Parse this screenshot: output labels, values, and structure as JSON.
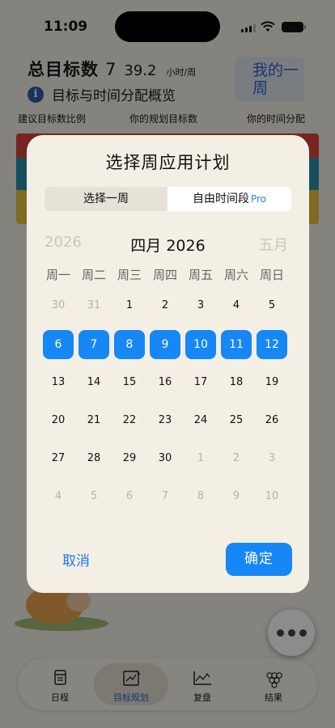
{
  "status_bar": {
    "time": "11:09"
  },
  "header": {
    "title": "总目标数",
    "goal_count": "7",
    "hours": "39.2",
    "unit": "小时/周",
    "my_week_button": "我的一周"
  },
  "overview": {
    "info_icon": "i",
    "label": "目标与时间分配概览"
  },
  "columns": [
    "建议目标数比例",
    "你的规划目标数",
    "你的时间分配"
  ],
  "modal": {
    "title": "选择周应用计划",
    "segments": [
      {
        "label": "选择一周",
        "pro": ""
      },
      {
        "label": "自由时间段",
        "pro": "Pro"
      }
    ],
    "prev_label": "2026",
    "current_label": "四月 2026",
    "next_label": "五月",
    "weekdays": [
      "周一",
      "周二",
      "周三",
      "周四",
      "周五",
      "周六",
      "周日"
    ],
    "weeks": [
      [
        "30",
        "31",
        "1",
        "2",
        "3",
        "4",
        "5"
      ],
      [
        "6",
        "7",
        "8",
        "9",
        "10",
        "11",
        "12"
      ],
      [
        "13",
        "14",
        "15",
        "16",
        "17",
        "18",
        "19"
      ],
      [
        "20",
        "21",
        "22",
        "23",
        "24",
        "25",
        "26"
      ],
      [
        "27",
        "28",
        "29",
        "30",
        "1",
        "2",
        "3"
      ],
      [
        "4",
        "5",
        "6",
        "7",
        "8",
        "9",
        "10"
      ]
    ],
    "selected_week": 1,
    "cancel_label": "取消",
    "confirm_label": "确定"
  },
  "more_icon": "more-dots-icon",
  "tabs": [
    {
      "label": "日程",
      "icon": "calendar-icon",
      "active": false
    },
    {
      "label": "目标规划",
      "icon": "goal-plan-icon",
      "active": true
    },
    {
      "label": "复盘",
      "icon": "chart-icon",
      "active": false
    },
    {
      "label": "结果",
      "icon": "grapes-icon",
      "active": false
    }
  ],
  "colors": {
    "accent": "#1787f5",
    "bar_red": "#d8463a",
    "bar_blue": "#2d8fb0",
    "bar_yellow": "#e8c43c"
  }
}
